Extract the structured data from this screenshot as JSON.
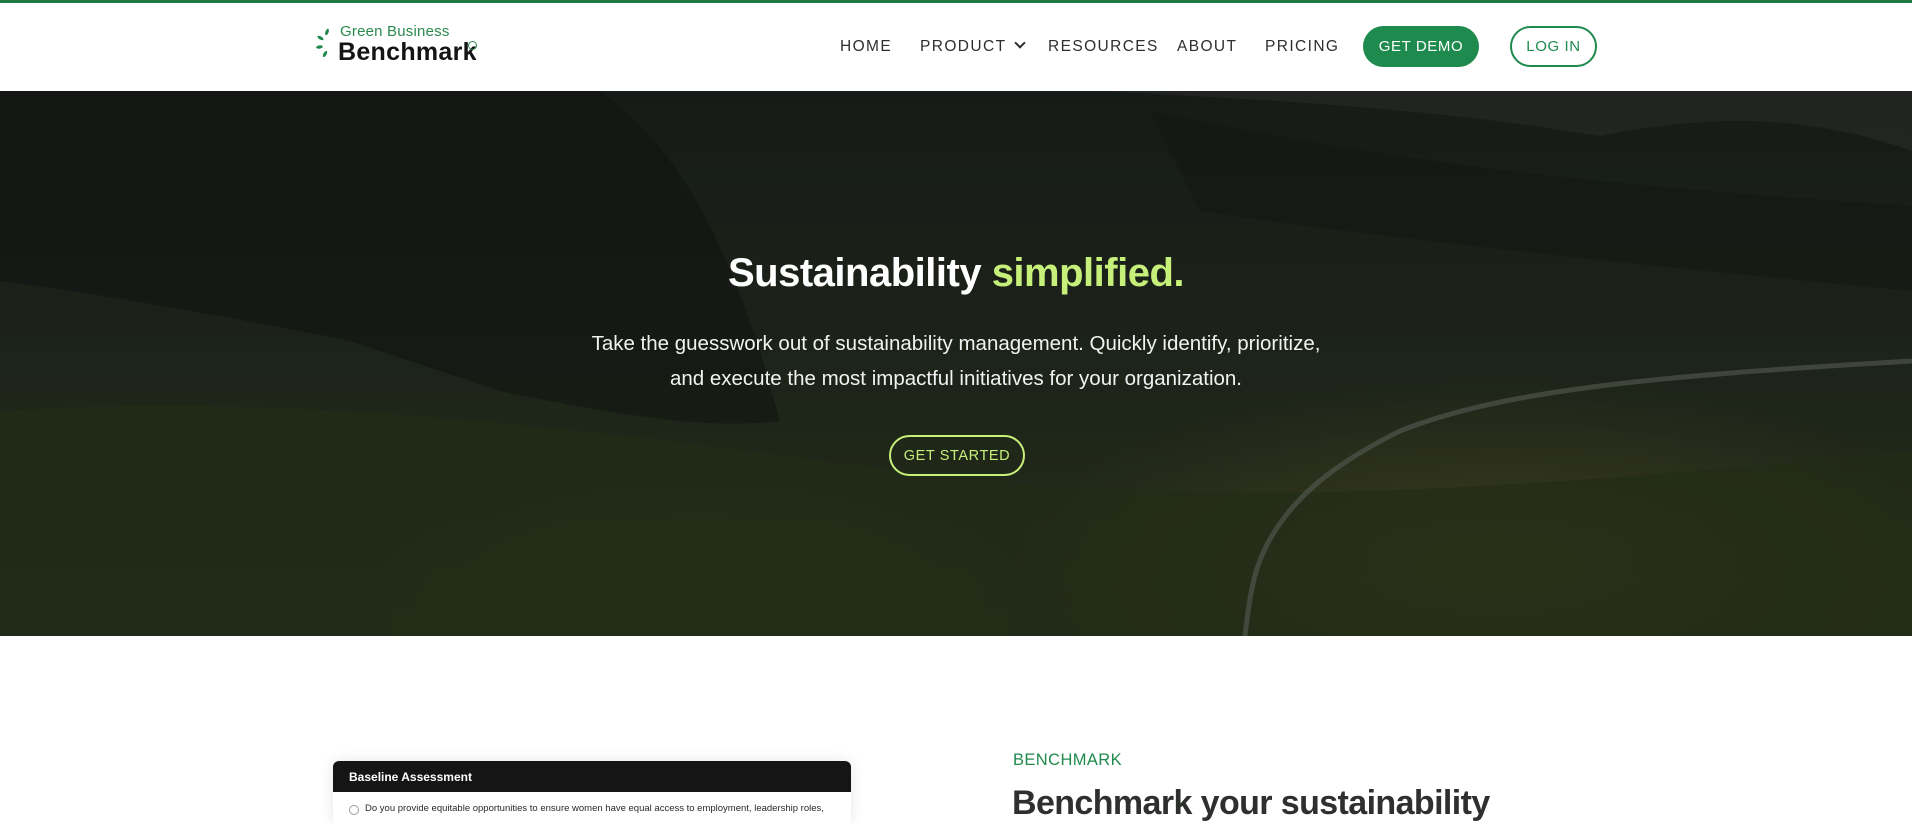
{
  "brand": {
    "logo_small": "Green Business",
    "logo_big": "Benchmark",
    "accent_color": "#1f8a4e",
    "highlight_color": "#c6f07a"
  },
  "nav": {
    "home": "HOME",
    "product": "PRODUCT",
    "resources": "RESOURCES",
    "about": "ABOUT",
    "pricing": "PRICING",
    "get_demo": "GET DEMO",
    "log_in": "LOG IN"
  },
  "hero": {
    "title_main": "Sustainability",
    "title_accent": "simplified.",
    "subtitle_line1": "Take the guesswork out of sustainability management. Quickly identify, prioritize,",
    "subtitle_line2": "and execute the most impactful initiatives for your organization.",
    "cta": "GET STARTED"
  },
  "benchmark_section": {
    "card_title": "Baseline Assessment",
    "card_question": "Do you provide equitable opportunities to ensure women have equal access to employment, leadership roles,",
    "eyebrow": "BENCHMARK",
    "heading": "Benchmark your sustainability"
  }
}
